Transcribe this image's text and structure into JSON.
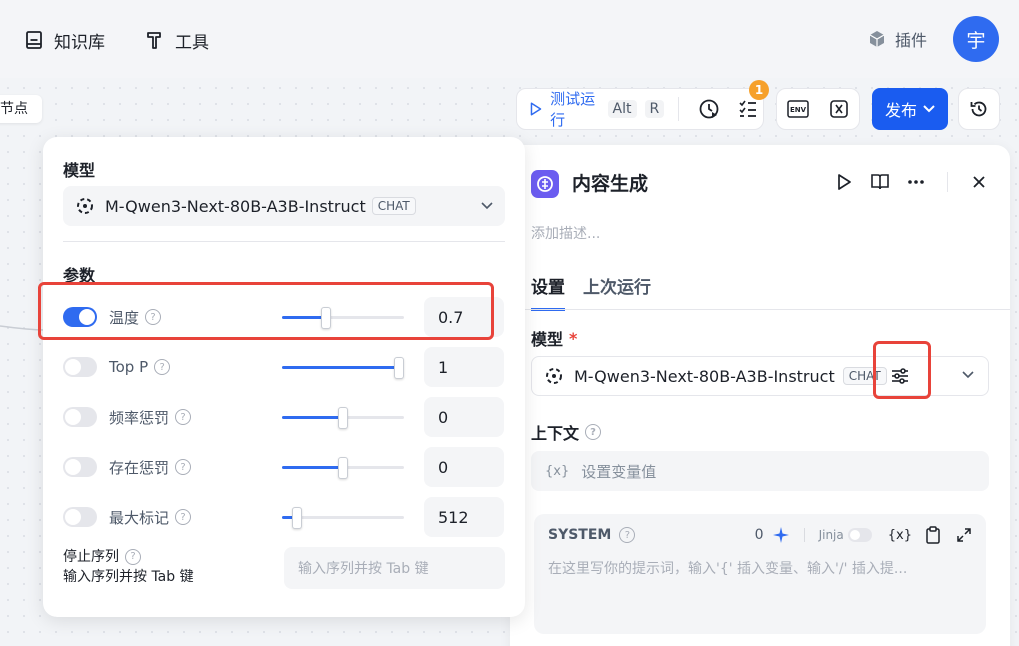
{
  "topbar": {
    "knowledge_label": "知识库",
    "tools_label": "工具",
    "plugins_label": "插件",
    "avatar_text": "宇"
  },
  "canvas": {
    "node_chip": "节点"
  },
  "toolbar": {
    "test_run_label": "测试运行",
    "shortcut_alt": "Alt",
    "shortcut_r": "R",
    "badge_count": "1",
    "env_label": "ENV",
    "publish_label": "发布"
  },
  "model_popup": {
    "model_title": "模型",
    "model_name": "M-Qwen3-Next-80B-A3B-Instruct",
    "model_tag": "CHAT",
    "params_title": "参数",
    "params": [
      {
        "label": "温度",
        "value": "0.7",
        "enabled": true,
        "fraction": 0.36
      },
      {
        "label": "Top P",
        "value": "1",
        "enabled": false,
        "fraction": 1.0
      },
      {
        "label": "频率惩罚",
        "value": "0",
        "enabled": false,
        "fraction": 0.5
      },
      {
        "label": "存在惩罚",
        "value": "0",
        "enabled": false,
        "fraction": 0.5
      },
      {
        "label": "最大标记",
        "value": "512",
        "enabled": false,
        "fraction": 0.12
      }
    ],
    "stop_label": "停止序列",
    "stop_hint": "输入序列并按 Tab 键",
    "stop_placeholder": "输入序列并按 Tab 键"
  },
  "panel": {
    "title": "内容生成",
    "description_placeholder": "添加描述...",
    "tabs": [
      "设置",
      "上次运行"
    ],
    "model_label": "模型",
    "required_mark": "*",
    "model_name": "M-Qwen3-Next-80B-A3B-Instruct",
    "model_tag": "CHAT",
    "context_label": "上下文",
    "context_icon_text": "{x}",
    "context_placeholder": "设置变量值",
    "system": {
      "label": "SYSTEM",
      "count": "0",
      "jinja_label": "Jinja",
      "var_icon_text": "{x}",
      "placeholder": "在这里写你的提示词，输入'{' 插入变量、输入'/' 插入提..."
    }
  },
  "colors": {
    "accent": "#2f6bf0",
    "highlight": "#e8433a",
    "badge": "#f6a02a",
    "node_icon": "#6b5cf0"
  }
}
